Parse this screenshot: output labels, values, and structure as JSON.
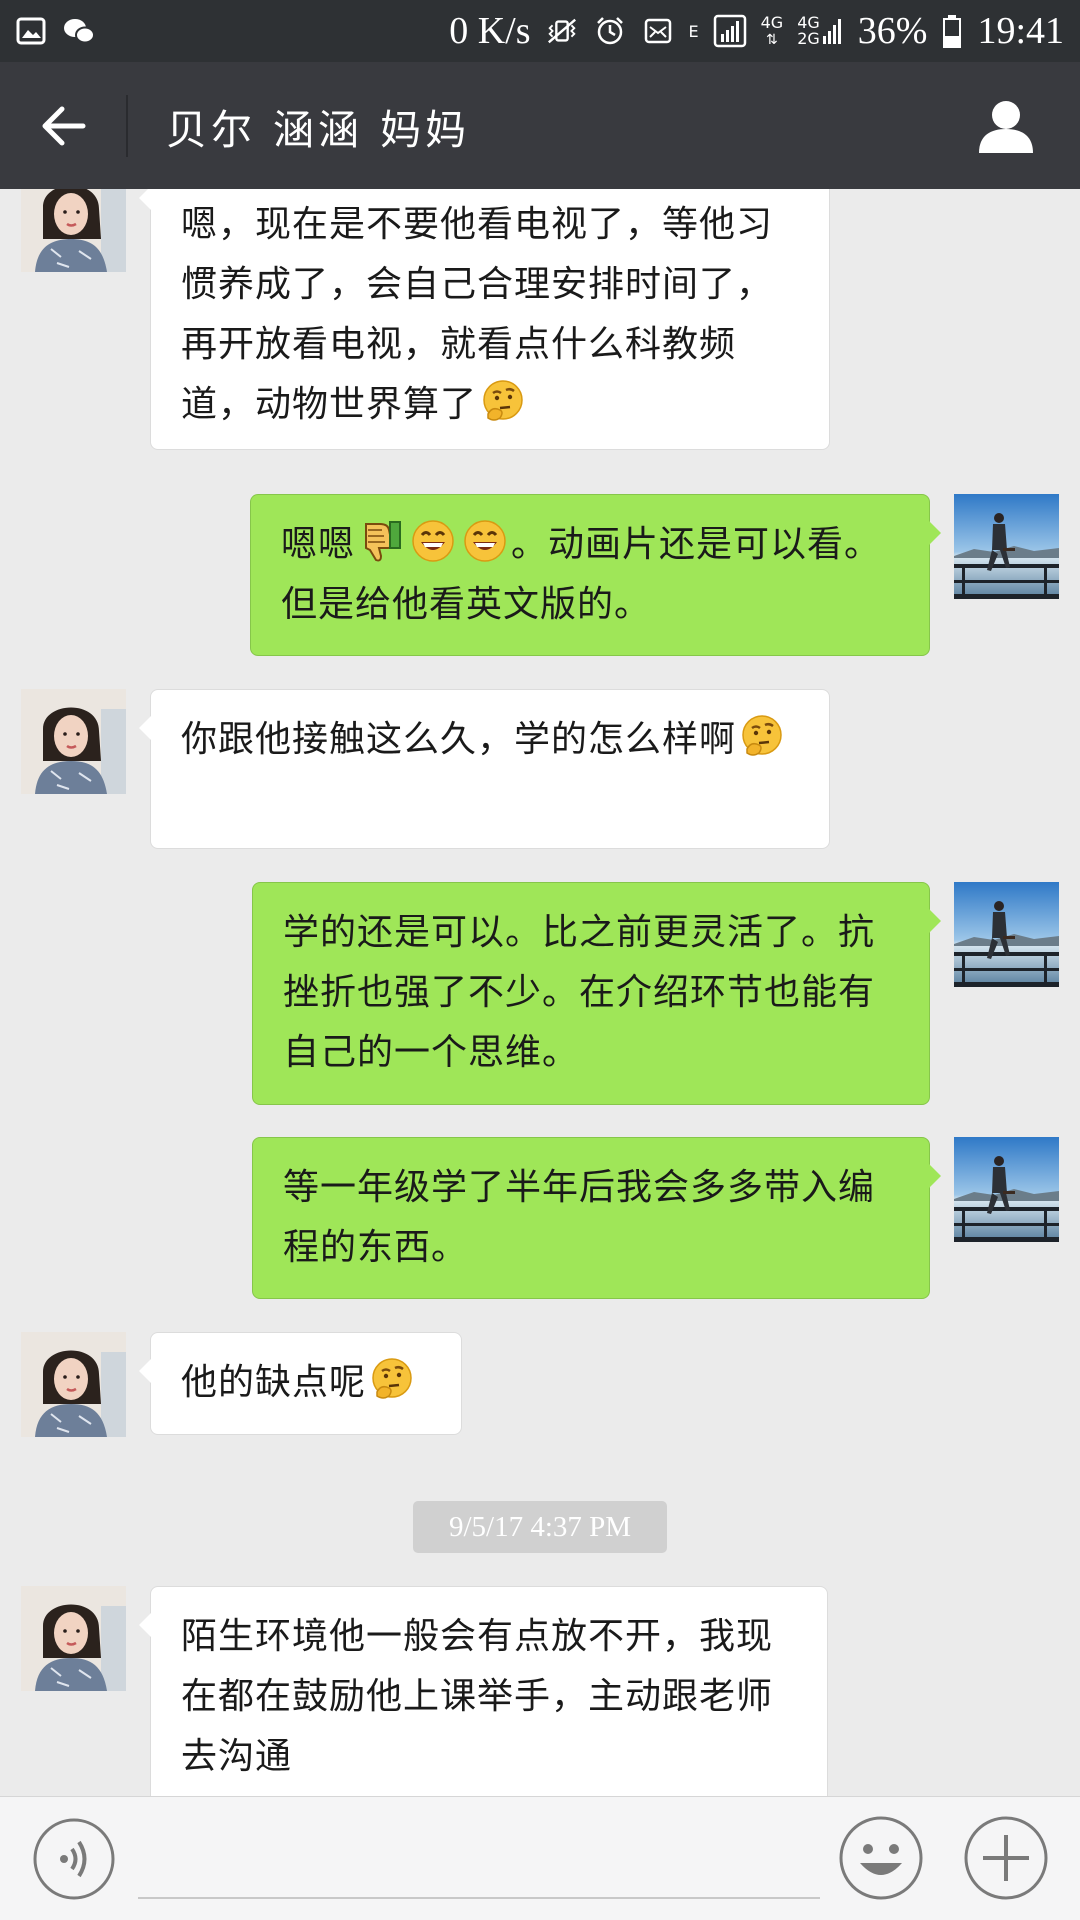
{
  "status_bar": {
    "speed": "0 K/s",
    "network_e": "E",
    "network_4g": "4G",
    "network_4g2g_top": "4G",
    "network_4g2g_bottom": "2G",
    "battery": "36%",
    "time": "19:41"
  },
  "header": {
    "title": "贝尔 涵涵 妈妈"
  },
  "messages": [
    {
      "direction": "incoming",
      "text": "嗯，现在是不要他看电视了，等他习惯养成了，会自己合理安排时间了，再开放看电视，就看点什么科教频道，动物世界算了"
    },
    {
      "direction": "outgoing",
      "text_a": "嗯嗯",
      "text_b": "。动画片还是可以看。但是给他看英文版的。"
    },
    {
      "direction": "incoming",
      "text": "你跟他接触这么久，学的怎么样啊"
    },
    {
      "direction": "outgoing",
      "text": "学的还是可以。比之前更灵活了。抗挫折也强了不少。在介绍环节也能有自己的一个思维。"
    },
    {
      "direction": "outgoing",
      "text": "等一年级学了半年后我会多多带入编程的东西。"
    },
    {
      "direction": "incoming",
      "text": "他的缺点呢"
    },
    {
      "direction": "incoming",
      "text": "陌生环境他一般会有点放不开，我现在都在鼓励他上课举手，主动跟老师去沟通"
    }
  ],
  "timestamp": "9/5/17 4:37 PM",
  "input": {
    "value": ""
  },
  "colors": {
    "status_bar_bg": "#2e3134",
    "title_bar_bg": "#393a3f",
    "chat_bg": "#ebebeb",
    "outgoing_bubble": "#9fe658",
    "incoming_bubble": "#ffffff"
  }
}
